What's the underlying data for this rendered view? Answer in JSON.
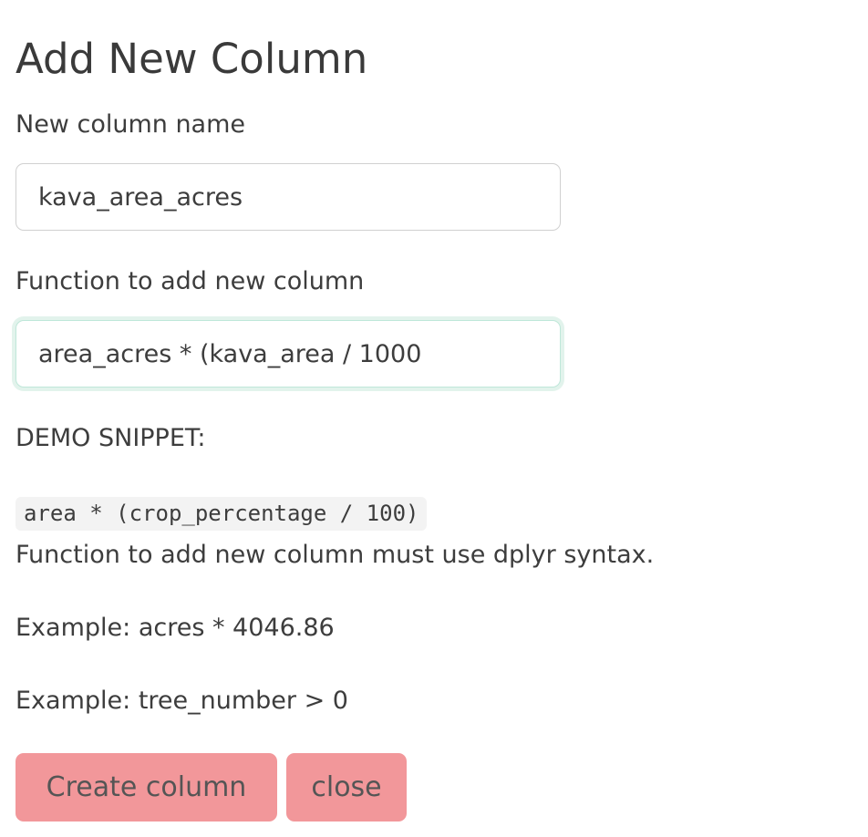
{
  "dialog": {
    "title": "Add New Column"
  },
  "column_name": {
    "label": "New column name",
    "value": "kava_area_acres"
  },
  "function_field": {
    "label": "Function to add new column",
    "value": "area_acres * (kava_area / 1000"
  },
  "demo": {
    "heading": "DEMO SNIPPET:",
    "snippet": "area * (crop_percentage / 100)",
    "note": "Function to add new column must use dplyr syntax.",
    "example_1": "Example: acres * 4046.86",
    "example_2": "Example: tree_number > 0"
  },
  "actions": {
    "create_label": "Create column",
    "close_label": "close"
  },
  "colors": {
    "button_bg": "#f2979a",
    "focus_ring": "#bfe7d9"
  }
}
